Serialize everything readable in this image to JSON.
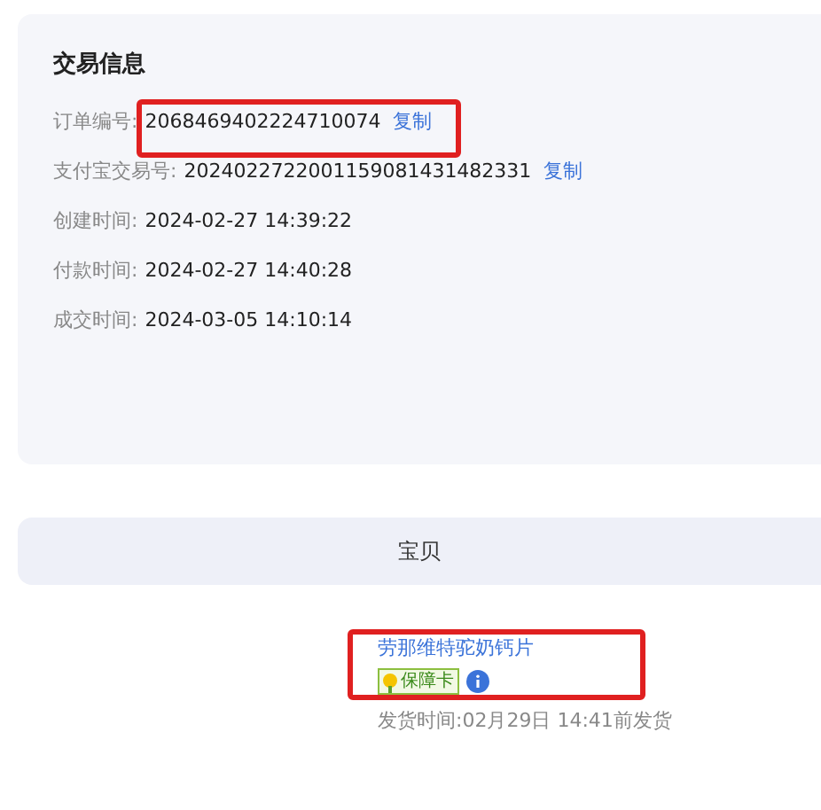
{
  "trade_info": {
    "title": "交易信息",
    "rows": [
      {
        "label": "订单编号:",
        "value": "2068469402224710074",
        "action": "复制"
      },
      {
        "label": "支付宝交易号:",
        "value": "2024022722001159081431482331",
        "action": "复制"
      },
      {
        "label": "创建时间:",
        "value": "2024-02-27 14:39:22"
      },
      {
        "label": "付款时间:",
        "value": "2024-02-27 14:40:28"
      },
      {
        "label": "成交时间:",
        "value": "2024-03-05 14:10:14"
      }
    ]
  },
  "items_header": "宝贝",
  "item": {
    "name": "劳那维特驼奶钙片",
    "badge": "保障卡",
    "shipping": "发货时间:02月29日 14:41前发货"
  }
}
